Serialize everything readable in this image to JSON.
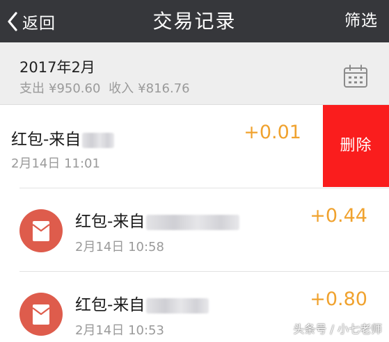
{
  "nav": {
    "back_label": "返回",
    "title": "交易记录",
    "filter_label": "筛选"
  },
  "month": {
    "label": "2017年2月",
    "expense_label": "支出",
    "expense_value": "¥950.60",
    "income_label": "收入",
    "income_value": "¥816.76",
    "icon": "calendar-icon"
  },
  "transactions": [
    {
      "title": "红包-来自",
      "time": "2月14日 11:01",
      "amount": "+0.01",
      "delete_label": "删除"
    },
    {
      "title": "红包-来自",
      "time": "2月14日 10:58",
      "amount": "+0.44",
      "icon": "red-envelope-icon"
    },
    {
      "title": "红包-来自",
      "time": "2月14日 10:53",
      "amount": "+0.80",
      "icon": "red-envelope-icon"
    }
  ],
  "watermark": "头条号 / 小七老师",
  "colors": {
    "navbar": "#36373b",
    "amount": "#f0a22e",
    "delete": "#fa1d1d",
    "envelope": "#de5c4c"
  }
}
